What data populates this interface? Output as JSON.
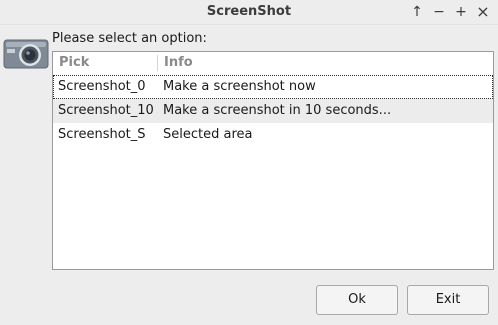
{
  "window": {
    "title": "ScreenShot",
    "controls": {
      "maximize": "↑",
      "minimize": "−",
      "restore": "+",
      "close": "×"
    }
  },
  "dialog": {
    "prompt": "Please select an option:",
    "columns": [
      "Pick",
      "Info"
    ],
    "rows": [
      {
        "pick": "Screenshot_0",
        "info": "Make a screenshot now"
      },
      {
        "pick": "Screenshot_10",
        "info": "Make a screenshot in 10 seconds..."
      },
      {
        "pick": "Screenshot_S",
        "info": "Selected area"
      }
    ]
  },
  "buttons": {
    "ok": "Ok",
    "exit": "Exit"
  },
  "colors": {
    "window_bg": "#ededed",
    "list_bg": "#ffffff",
    "row_highlight": "#ececec"
  },
  "icons": {
    "app": "camera-icon"
  }
}
